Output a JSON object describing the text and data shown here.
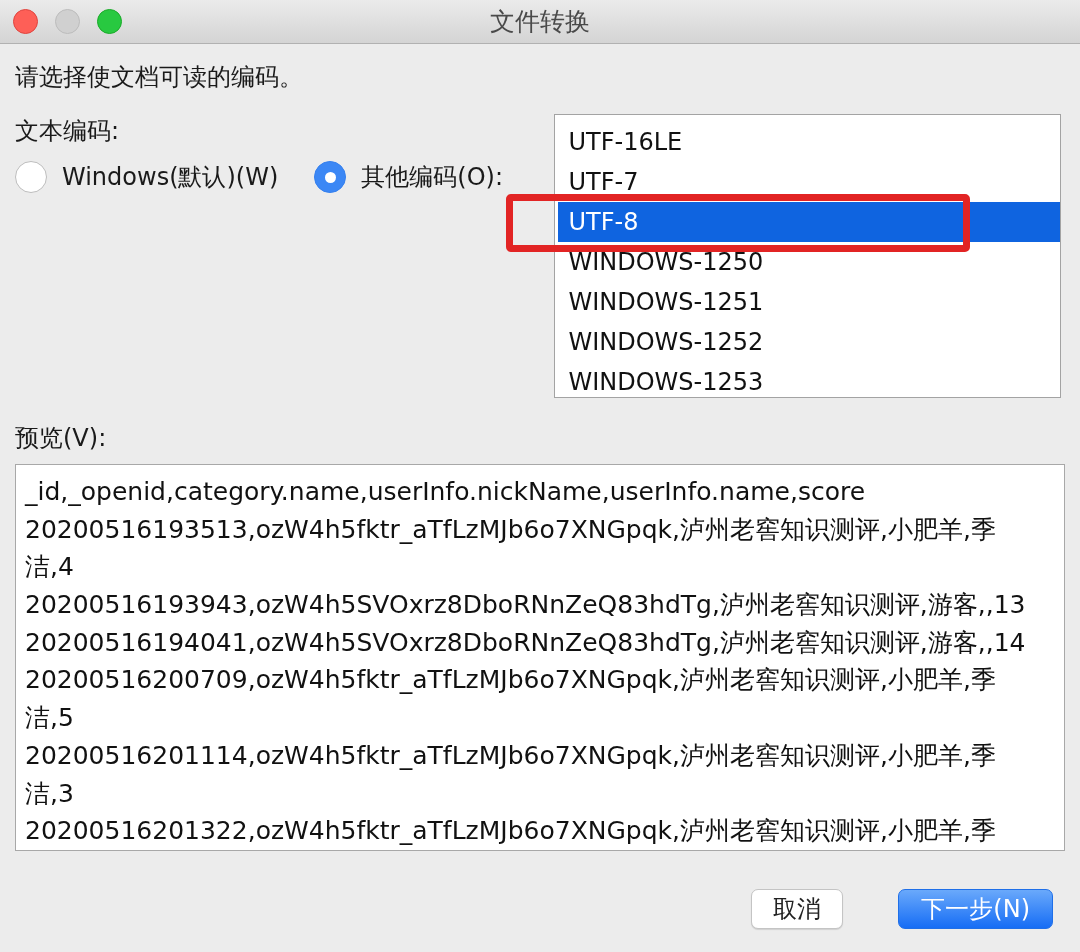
{
  "window": {
    "title": "文件转换",
    "buttons": [
      {
        "kind": "close",
        "disabled": false
      },
      {
        "kind": "minimize",
        "disabled": true
      },
      {
        "kind": "zoom",
        "disabled": false
      }
    ]
  },
  "instruction": "请选择使文档可读的编码。",
  "encoding": {
    "label": "文本编码:",
    "options": [
      {
        "label": "Windows(默认)(W)",
        "selected": false
      },
      {
        "label": "其他编码(O):",
        "selected": true
      }
    ],
    "list": [
      {
        "label": "UTF-16LE",
        "selected": false
      },
      {
        "label": "UTF-7",
        "selected": false
      },
      {
        "label": "UTF-8",
        "selected": true
      },
      {
        "label": "WINDOWS-1250",
        "selected": false
      },
      {
        "label": "WINDOWS-1251",
        "selected": false
      },
      {
        "label": "WINDOWS-1252",
        "selected": false
      },
      {
        "label": "WINDOWS-1253",
        "selected": false
      }
    ]
  },
  "annotation": {
    "kind": "frame"
  },
  "preview": {
    "label": "预览(V):",
    "lines": [
      "_id,_openid,category.name,userInfo.nickName,userInfo.name,score",
      "20200516193513,ozW4h5fktr_aTfLzMJb6o7XNGpqk,泸州老窖知识测评,小肥羊,季",
      "洁,4",
      "20200516193943,ozW4h5SVOxrz8DboRNnZeQ83hdTg,泸州老窖知识测评,游客,,13",
      "20200516194041,ozW4h5SVOxrz8DboRNnZeQ83hdTg,泸州老窖知识测评,游客,,14",
      "20200516200709,ozW4h5fktr_aTfLzMJb6o7XNGpqk,泸州老窖知识测评,小肥羊,季",
      "洁,5",
      "20200516201114,ozW4h5fktr_aTfLzMJb6o7XNGpqk,泸州老窖知识测评,小肥羊,季",
      "洁,3",
      "20200516201322,ozW4h5fktr_aTfLzMJb6o7XNGpqk,泸州老窖知识测评,小肥羊,季"
    ]
  },
  "buttons": [
    {
      "label": "取消",
      "kind": "secondary"
    },
    {
      "label": "下一步(N)",
      "kind": "primary"
    }
  ]
}
